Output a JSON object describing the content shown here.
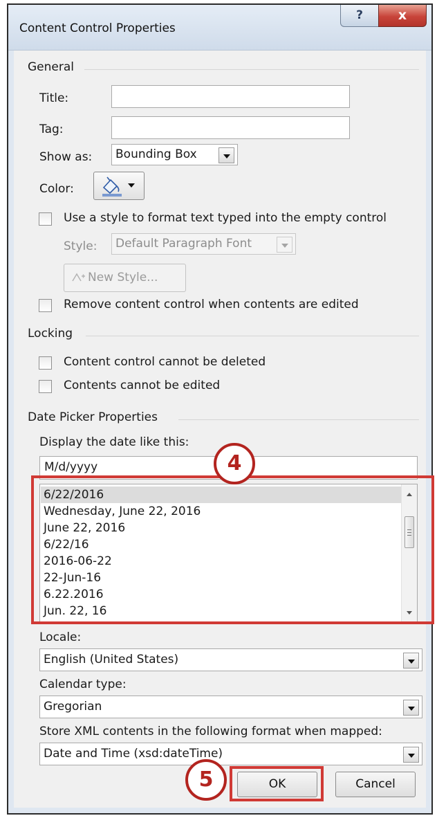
{
  "window": {
    "title": "Content Control Properties",
    "help_glyph": "?",
    "close_glyph": "x"
  },
  "general": {
    "heading": "General",
    "title_label": "Title:",
    "title_value": "",
    "tag_label": "Tag:",
    "tag_value": "",
    "show_as_label": "Show as:",
    "show_as_value": "Bounding Box",
    "color_label": "Color:",
    "use_style_label": "Use a style to format text typed into the empty control",
    "style_label": "Style:",
    "style_value": "Default Paragraph Font",
    "new_style_label": "New Style...",
    "remove_label": "Remove content control when contents are edited"
  },
  "locking": {
    "heading": "Locking",
    "cannot_delete_label": "Content control cannot be deleted",
    "cannot_edit_label": "Contents cannot be edited"
  },
  "date_picker": {
    "heading": "Date Picker Properties",
    "display_label": "Display the date like this:",
    "format_value": "M/d/yyyy",
    "formats": [
      "6/22/2016",
      "Wednesday, June 22, 2016",
      "June 22, 2016",
      "6/22/16",
      "2016-06-22",
      "22-Jun-16",
      "6.22.2016",
      "Jun. 22, 16"
    ],
    "locale_label": "Locale:",
    "locale_value": "English (United States)",
    "calendar_label": "Calendar type:",
    "calendar_value": "Gregorian",
    "store_label": "Store XML contents in the following format when mapped:",
    "store_value": "Date and Time (xsd:dateTime)"
  },
  "buttons": {
    "ok": "OK",
    "cancel": "Cancel"
  },
  "annotations": {
    "step4": "4",
    "step5": "5"
  },
  "colors": {
    "annotation_red": "#d03a35",
    "badge_red": "#b3241f",
    "dialog_bg": "#f0f0f0"
  },
  "icons": {
    "color_button": "paint-bucket-icon",
    "new_style": "new-style-icon",
    "dropdown": "chevron-down-icon"
  }
}
